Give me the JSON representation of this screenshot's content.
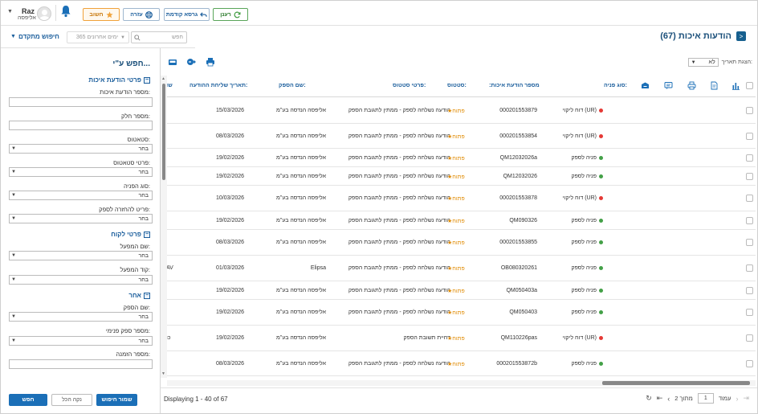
{
  "topbar": {
    "user": {
      "name": "Raz",
      "company": "אליפסה"
    },
    "buttons": {
      "important": "חשוב",
      "help": "עזרה",
      "back_to_previous": "גרסא קודמת",
      "refresh": "רענן"
    }
  },
  "search": {
    "advanced_label": "חיפוש מתקדם",
    "period": "365 ימים אחרונים",
    "placeholder": "חפש"
  },
  "page": {
    "title": "הודעות איכות (67)"
  },
  "filter_panel": {
    "title": "חפש ע\"י...",
    "sections": {
      "quality_details": "פרטי הודעת איכות",
      "customer_details": "פרטי לקוח",
      "other": "אחר"
    },
    "labels": {
      "quality_notice_number": "מספר הודעת איכות:",
      "part_number": "מספר חלק:",
      "status": "סטאטוס:",
      "status_details": "פרטי סטאטוס:",
      "request_type": "סוג הפניה:",
      "return_to_supplier": "פריט להחזרה לספק:",
      "operator_name": "שם המפעל:",
      "operator_code": "קוד המפעל:",
      "supplier_name": "שם הספק:",
      "internal_supplier_number": "מספר ספק פנימי:",
      "order_number": "מספר הזמנה:"
    },
    "select_placeholder": "בחר",
    "buttons": {
      "search": "חפש",
      "clear_all": "נקה הכל",
      "save_search": "שמור חיפוש"
    }
  },
  "toolbar": {
    "date_display_label": "הצגת תאריך:",
    "date_display_value": "לא"
  },
  "grid": {
    "columns": {
      "request_type": "סוג פניה:",
      "quality_number": ":מספר הודעת איכות",
      "status": "סטטוס:",
      "status_details": "פרטי סטטוס:",
      "supplier_name": "שם הספק:",
      "sent_date": "תאריך שליחת ההודעה:",
      "extra": "שו"
    },
    "rows": [
      {
        "type": "דוח ליקוי (UR)",
        "type_color": "#e53935",
        "number": "000201553879",
        "status": "פתוח",
        "details": "הודעה נשלחה לספק - ממתין לתגובת הספק",
        "supplier": "אליפסה הנדסה בע\"מ",
        "date": "15/03/2026",
        "extra": ""
      },
      {
        "type": "דוח ליקוי (UR)",
        "type_color": "#e53935",
        "number": "000201553854",
        "status": "פתוח",
        "details": "הודעה נשלחה לספק - ממתין לתגובת הספק",
        "supplier": "אליפסה הנדסה בע\"מ",
        "date": "08/03/2026",
        "extra": ""
      },
      {
        "type": "פניה לספק",
        "type_color": "#43a047",
        "number": "QM12032026a",
        "status": "פתוח",
        "details": "הודעה נשלחה לספק - ממתין לתגובת הספק",
        "supplier": "אליפסה הנדסה בע\"מ",
        "date": "19/02/2026",
        "extra": ""
      },
      {
        "type": "פניה לספק",
        "type_color": "#43a047",
        "number": "QM12032026",
        "status": "פתוח",
        "details": "הודעה נשלחה לספק - ממתין לתגובת הספק",
        "supplier": "אליפסה הנדסה בע\"מ",
        "date": "19/02/2026",
        "extra": ""
      },
      {
        "type": "דוח ליקוי (UR)",
        "type_color": "#e53935",
        "number": "000201553878",
        "status": "פתוח",
        "details": "הודעה נשלחה לספק - ממתין לתגובת הספק",
        "supplier": "אליפסה הנדסה בע\"מ",
        "date": "10/03/2026",
        "extra": ""
      },
      {
        "type": "פניה לספק",
        "type_color": "#43a047",
        "number": "QM090326",
        "status": "פתוח",
        "details": "הודעה נשלחה לספק - ממתין לתגובת הספק",
        "supplier": "אליפסה הנדסה בע\"מ",
        "date": "19/02/2026",
        "extra": ""
      },
      {
        "type": "פניה לספק",
        "type_color": "#43a047",
        "number": "000201553855",
        "status": "פתוח",
        "details": "הודעה נשלחה לספק - ממתין לתגובת הספק",
        "supplier": "אליפסה הנדסה בע\"מ",
        "date": "08/03/2026",
        "extra": ""
      },
      {
        "type": "פניה לספק",
        "type_color": "#43a047",
        "number": "OB080320261",
        "status": "פתוח",
        "details": "הודעה נשלחה לספק - ממתין לתגובת הספק",
        "supplier": "Elipsa",
        "date": "01/03/2026",
        "extra": "AV"
      },
      {
        "type": "פניה לספק",
        "type_color": "#43a047",
        "number": "QM050403a",
        "status": "פתוח",
        "details": "הודעה נשלחה לספק - ממתין לתגובת הספק",
        "supplier": "אליפסה הנדסה בע\"מ",
        "date": "19/02/2026",
        "extra": ""
      },
      {
        "type": "פניה לספק",
        "type_color": "#43a047",
        "number": "QM050403",
        "status": "פתוח",
        "details": "הודעה נשלחה לספק - ממתין לתגובת הספק",
        "supplier": "אליפסה הנדסה בע\"מ",
        "date": "19/02/2026",
        "extra": ""
      },
      {
        "type": "דוח ליקוי (UR)",
        "type_color": "#e53935",
        "number": "QM110226pas",
        "status": "פתוח",
        "details": "דחיית תשובת הספק",
        "supplier": "אליפסה הנדסה בע\"מ",
        "date": "19/02/2026",
        "extra": "כו"
      },
      {
        "type": "פניה לספק",
        "type_color": "#43a047",
        "number": "000201553872b",
        "status": "פתוח",
        "details": "הודעה נשלחה לספק - ממתין לתגובת הספק",
        "supplier": "אליפסה הנדסה בע\"מ",
        "date": "08/03/2026",
        "extra": ""
      }
    ]
  },
  "pager": {
    "displaying": "Displaying 1 - 40 of 67",
    "page_label": "עמוד",
    "current_page": "1",
    "of_label": "מתוך 2"
  },
  "colors": {
    "accent": "#1b5e9c",
    "brand": "#17608f",
    "status_open": "#e08a00"
  }
}
